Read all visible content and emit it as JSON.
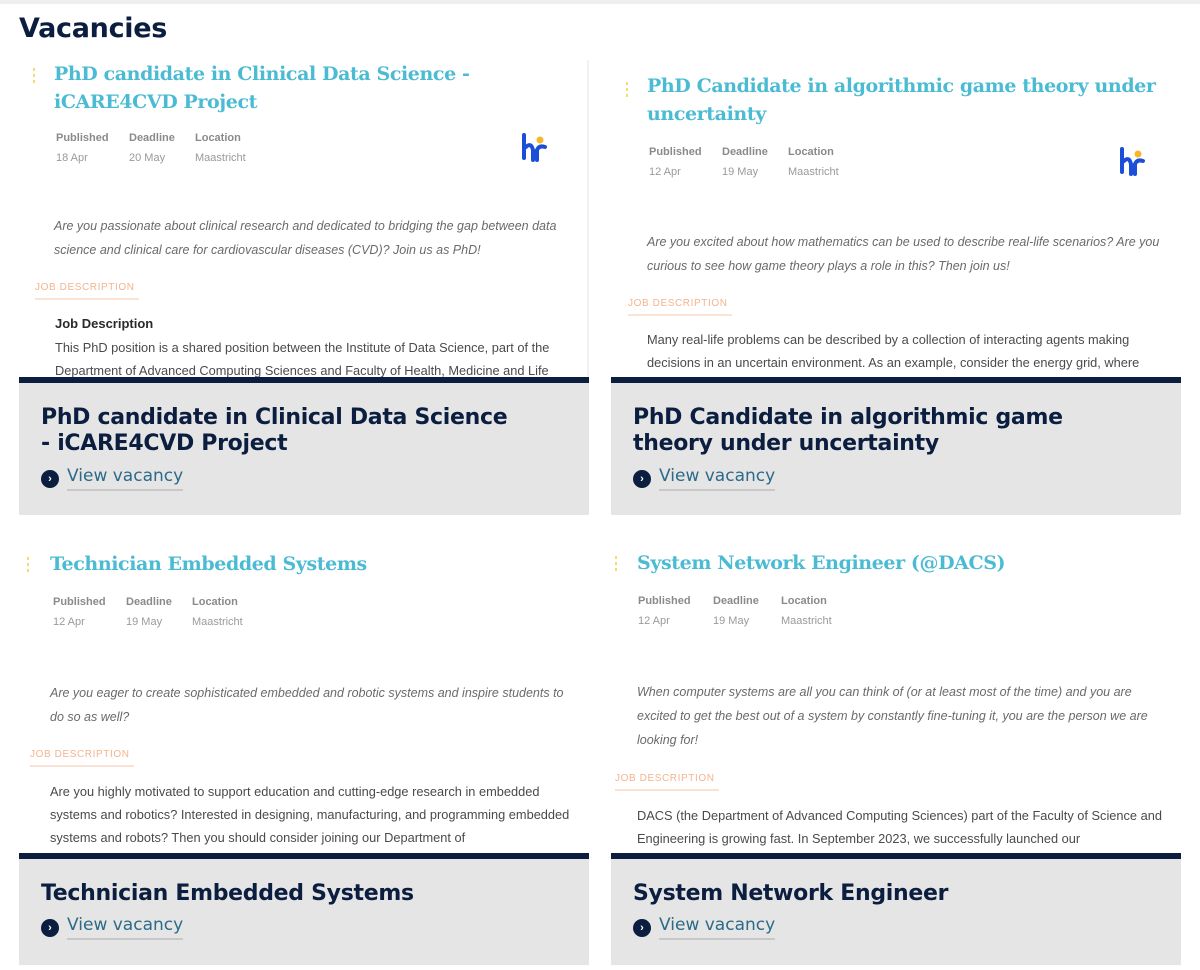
{
  "page": {
    "title": "Vacancies"
  },
  "labels": {
    "published": "Published",
    "deadline": "Deadline",
    "location": "Location",
    "job_description_tag": "JOB DESCRIPTION",
    "view_vacancy": "View vacancy"
  },
  "colors": {
    "navy": "#0b1e3f",
    "title_teal": "#4bbbd3",
    "tag_orange": "#f3b48d",
    "footer_bg": "#e5e5e5",
    "link": "#2b6a88"
  },
  "vacancies": [
    {
      "title": "PhD candidate in Clinical Data Science - iCARE4CVD Project",
      "published": "18 Apr",
      "deadline": "20 May",
      "location": "Maastricht",
      "hr_logo": true,
      "intro": "Are you passionate about clinical research and dedicated to bridging the gap between data science and clinical care for cardiovascular diseases (CVD)? Join us as PhD!",
      "description_heading": "Job Description",
      "description": "This PhD position is a shared position between the Institute of Data Science, part of the Department of Advanced Computing Sciences and Faculty of Health, Medicine and Life",
      "footer_title": "PhD candidate in Clinical Data Science - iCARE4CVD Project"
    },
    {
      "title": "PhD Candidate in algorithmic game theory under uncertainty",
      "published": "12 Apr",
      "deadline": "19 May",
      "location": "Maastricht",
      "hr_logo": true,
      "intro": "Are you excited about how mathematics can be used to describe real-life scenarios? Are you curious to see how game theory plays a role in this? Then join us!",
      "description": "Many real-life problems can be described by a collection of interacting agents making decisions in an uncertain environment. As an example, consider the energy grid, where",
      "footer_title": "PhD Candidate in algorithmic game theory under uncertainty"
    },
    {
      "title": "Technician Embedded Systems",
      "published": "12 Apr",
      "deadline": "19 May",
      "location": "Maastricht",
      "hr_logo": false,
      "intro": "Are you eager to create sophisticated embedded and robotic systems and inspire students to do so as well?",
      "description": "Are you highly motivated to support education and cutting-edge research in embedded systems and robotics? Interested in designing, manufacturing, and programming embedded systems and robots? Then you should consider joining our Department of",
      "footer_title": "Technician Embedded Systems"
    },
    {
      "title": "System Network Engineer (@DACS)",
      "published": "12 Apr",
      "deadline": "19 May",
      "location": "Maastricht",
      "hr_logo": false,
      "intro": "When computer systems are all you can think of (or at least most of the time) and you are excited to get the best out of a system by constantly fine-tuning it, you are the person we are looking for!",
      "description": "DACS (the Department of Advanced Computing Sciences) part of the Faculty of Science and Engineering is growing fast. In September 2023, we successfully launched our",
      "footer_title": "System Network Engineer"
    }
  ]
}
